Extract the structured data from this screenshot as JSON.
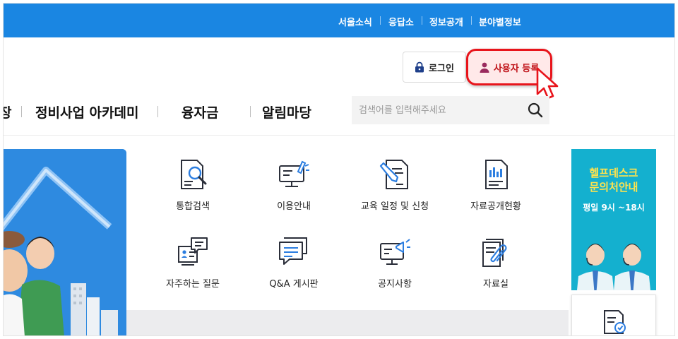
{
  "topbar": {
    "links": [
      "서울소식",
      "응답소",
      "정보공개",
      "분야별정보"
    ]
  },
  "header": {
    "login_label": "로그인",
    "register_label": "사용자 등록"
  },
  "gnb": {
    "partial_item": "장",
    "items": [
      "정비사업 아카데미",
      "융자금",
      "알림마당"
    ]
  },
  "search": {
    "placeholder": "검색어를 입력해주세요",
    "value": ""
  },
  "quick_menu": {
    "items": [
      {
        "label": "통합검색",
        "icon": "document-search-icon"
      },
      {
        "label": "이용안내",
        "icon": "monitor-guide-icon"
      },
      {
        "label": "교육 일정 및 신청",
        "icon": "pen-document-icon"
      },
      {
        "label": "자료공개현황",
        "icon": "chart-document-icon"
      },
      {
        "label": "자주하는 질문",
        "icon": "faq-board-icon"
      },
      {
        "label": "Q&A 게시판",
        "icon": "chat-bubbles-icon"
      },
      {
        "label": "공지사항",
        "icon": "megaphone-monitor-icon"
      },
      {
        "label": "자료실",
        "icon": "paperclip-document-icon"
      }
    ]
  },
  "helpdesk": {
    "title_line1": "헬프데스크",
    "title_line2": "문의처안내",
    "hours": "평일 9시 ~18시"
  },
  "colors": {
    "topbar": "#1a86e2",
    "highlight_border": "#e8141b",
    "helpdesk_bg": "#14b0cf",
    "helpdesk_title": "#ffe34d"
  }
}
